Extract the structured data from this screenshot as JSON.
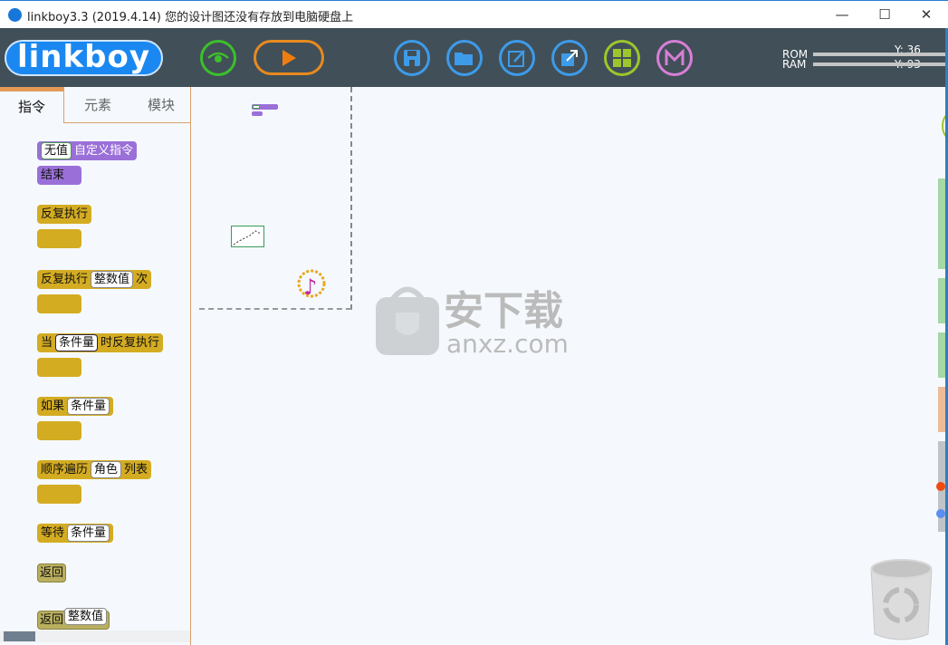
{
  "window": {
    "title": "linkboy3.3 (2019.4.14) 您的设计图还没有存放到电脑硬盘上",
    "minimize": "—",
    "maximize": "☐",
    "close": "✕"
  },
  "toolbar": {
    "logo": "linkboy",
    "icons": [
      "eye-icon",
      "play-icon",
      "save-icon",
      "open-folder-icon",
      "edit-icon",
      "export-icon",
      "grid-icon",
      "mail-icon"
    ],
    "rom_label": "ROM",
    "ram_label": "RAM",
    "rom_value": "Y: 36",
    "ram_value": "Y: 93"
  },
  "left_panel": {
    "tabs": [
      {
        "label": "指令",
        "active": true
      },
      {
        "label": "元素"
      },
      {
        "label": "模块"
      }
    ],
    "blocks": {
      "custom": {
        "slot": "无值",
        "label": "自定义指令",
        "end": "结束"
      },
      "repeat": {
        "label": "反复执行"
      },
      "repeat_n": {
        "label": "反复执行",
        "slot": "整数值",
        "suffix": "次"
      },
      "while": {
        "label": "当",
        "slot": "条件量",
        "suffix": "时反复执行"
      },
      "if": {
        "label": "如果",
        "slot": "条件量"
      },
      "foreach": {
        "label": "顺序遍历",
        "slot": "角色",
        "suffix": "列表"
      },
      "wait": {
        "label": "等待",
        "slot": "条件量"
      },
      "return": {
        "label": "返回"
      },
      "return_val": {
        "label": "返回",
        "slot": "整数值"
      }
    }
  },
  "watermark": {
    "brand": "安下载",
    "domain": "anxz.com"
  },
  "colors": {
    "toolbar": "#414f58",
    "logo": "#1a88f0",
    "control_block": "#d4ac22",
    "custom_block": "#9a70d8",
    "return_block": "#b9af5e",
    "accent_tab": "#e39a57"
  }
}
